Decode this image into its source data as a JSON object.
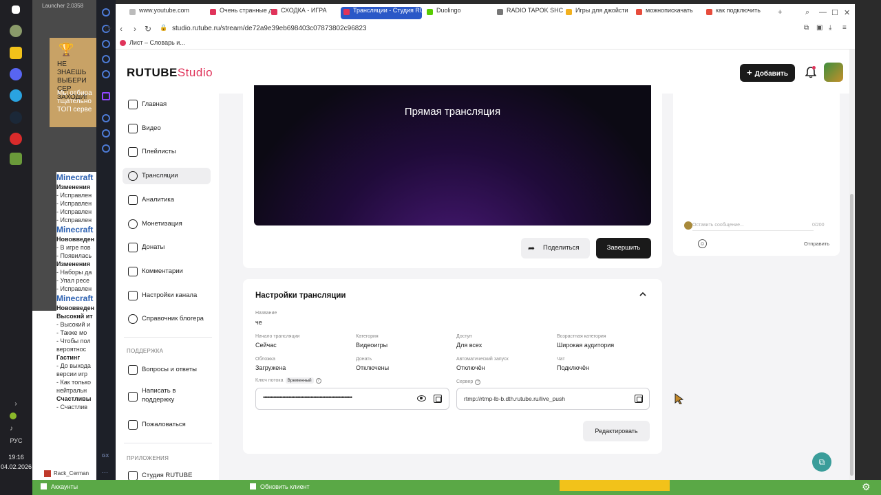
{
  "os": {
    "lang": "РУС",
    "time": "19:16",
    "date": "04.02.2026"
  },
  "bg_app": {
    "title": "Launcher 2.0358",
    "banner_line1": "НЕ ЗНАЕШЬ",
    "banner_line2": "ВЫБЕРИ СЕР",
    "banner_line3": "ЗАХОДИ!",
    "banner_line4": "Мы отбира",
    "banner_line5": "тщательно",
    "banner_line6": "ТОП серве",
    "wiki": [
      {
        "cls": "h",
        "text": "Minecraft"
      },
      {
        "cls": "b",
        "text": "Изменения"
      },
      {
        "cls": "",
        "text": "- Исправлен"
      },
      {
        "cls": "",
        "text": "- Исправлен"
      },
      {
        "cls": "",
        "text": "- Исправлен"
      },
      {
        "cls": "",
        "text": "- Исправлен"
      },
      {
        "cls": "h",
        "text": "Minecraft"
      },
      {
        "cls": "b",
        "text": "Нововведен"
      },
      {
        "cls": "",
        "text": "- В игре пов"
      },
      {
        "cls": "",
        "text": "- Появилась"
      },
      {
        "cls": "b",
        "text": "Изменения"
      },
      {
        "cls": "",
        "text": "- Наборы да"
      },
      {
        "cls": "",
        "text": "- Упал ресе"
      },
      {
        "cls": "",
        "text": "- Исправлен"
      },
      {
        "cls": "h",
        "text": "Minecraft"
      },
      {
        "cls": "b",
        "text": "Нововведен"
      },
      {
        "cls": "b",
        "text": "Высокий ит"
      },
      {
        "cls": "",
        "text": "- Высокий и"
      },
      {
        "cls": "",
        "text": "- Также мо"
      },
      {
        "cls": "",
        "text": "- Чтобы пол"
      },
      {
        "cls": "",
        "text": "вероятнос"
      },
      {
        "cls": "b",
        "text": "Гастинг"
      },
      {
        "cls": "",
        "text": "- До выхода"
      },
      {
        "cls": "",
        "text": "версии игр"
      },
      {
        "cls": "",
        "text": "- Как только"
      },
      {
        "cls": "",
        "text": "нейтральн"
      },
      {
        "cls": "b",
        "text": "Счастливы"
      },
      {
        "cls": "",
        "text": "- Счастлив"
      }
    ]
  },
  "browser": {
    "tabs": [
      {
        "label": "www.youtube.com",
        "color": "#bbbbbb"
      },
      {
        "label": "Очень странные д",
        "color": "#e0335a"
      },
      {
        "label": "СХОДКА - ИГРА",
        "color": "#e0335a"
      },
      {
        "label": "Трансляции - Студия RU",
        "color": "#e0335a"
      },
      {
        "label": "Duolingo",
        "color": "#58cc02"
      },
      {
        "label": "RADIO TAPOK SHC",
        "color": "#777777"
      },
      {
        "label": "Игры для джойсти",
        "color": "#f2b01e"
      },
      {
        "label": "можнопискачать",
        "color": "#e74c3c"
      },
      {
        "label": "как подключить",
        "color": "#e74c3c"
      }
    ],
    "url": "studio.rutube.ru/stream/de72a9e39eb698403c07873802c96823",
    "bookmark": "Лист – Словарь и..."
  },
  "header": {
    "logo_main": "RUTUBE",
    "logo_studio": "Studio",
    "add_label": "Добавить"
  },
  "sidebar": {
    "items": [
      {
        "label": "Главная",
        "icon": "home-icon"
      },
      {
        "label": "Видео",
        "icon": "video-icon"
      },
      {
        "label": "Плейлисты",
        "icon": "playlist-icon"
      },
      {
        "label": "Трансляции",
        "icon": "broadcast-icon"
      },
      {
        "label": "Аналитика",
        "icon": "analytics-icon"
      },
      {
        "label": "Монетизация",
        "icon": "monetization-icon"
      },
      {
        "label": "Донаты",
        "icon": "donate-icon"
      },
      {
        "label": "Комментарии",
        "icon": "comments-icon"
      },
      {
        "label": "Настройки канала",
        "icon": "settings-icon"
      },
      {
        "label": "Справочник блогера",
        "icon": "info-icon"
      }
    ],
    "support_heading": "ПОДДЕРЖКА",
    "support_items": [
      {
        "label": "Вопросы и ответы",
        "icon": "faq-icon"
      },
      {
        "label": "Написать в поддержку",
        "icon": "mail-icon"
      },
      {
        "label": "Пожаловаться",
        "icon": "flag-icon"
      }
    ],
    "apps_heading": "ПРИЛОЖЕНИЯ",
    "apps_item": "Студия RUTUBE"
  },
  "player": {
    "title": "Прямая трансляция",
    "share_label": "Поделиться",
    "end_label": "Завершить"
  },
  "chat": {
    "placeholder": "Оставить сообщение...",
    "counter": "0/200",
    "send_label": "Отправить"
  },
  "settings": {
    "title": "Настройки трансляции",
    "name_label": "Название",
    "name_value": "че",
    "start_label": "Начало трансляции",
    "start_value": "Сейчас",
    "category_label": "Категория",
    "category_value": "Видеоигры",
    "access_label": "Доступ",
    "access_value": "Для всех",
    "age_label": "Возрастная категория",
    "age_value": "Широкая аудитория",
    "cover_label": "Обложка",
    "cover_value": "Загружена",
    "donate_label": "Донать",
    "donate_value": "Отключены",
    "autostart_label": "Автоматический запуск",
    "autostart_value": "Отключён",
    "chat_label": "Чат",
    "chat_value": "Подключён",
    "key_label": "Ключ потока",
    "key_badge": "Временный",
    "key_value": "••••••••••••••••••••••••••••••••••••••••••••••••••••••••••••",
    "server_label": "Сервер",
    "server_value": "rtmp://rtmp-lb-b.dth.rutube.ru/live_push",
    "edit_label": "Редактировать"
  },
  "bottom": {
    "rack_tab": "Rack_Cerman",
    "accounts": "Аккаунты",
    "update": "Обновить клиент"
  },
  "colors": {
    "accent": "#e0335a",
    "dark_button": "#1a1a1a",
    "browser_active_tab": "#2a58c7",
    "launcher_green": "#5aa846"
  }
}
